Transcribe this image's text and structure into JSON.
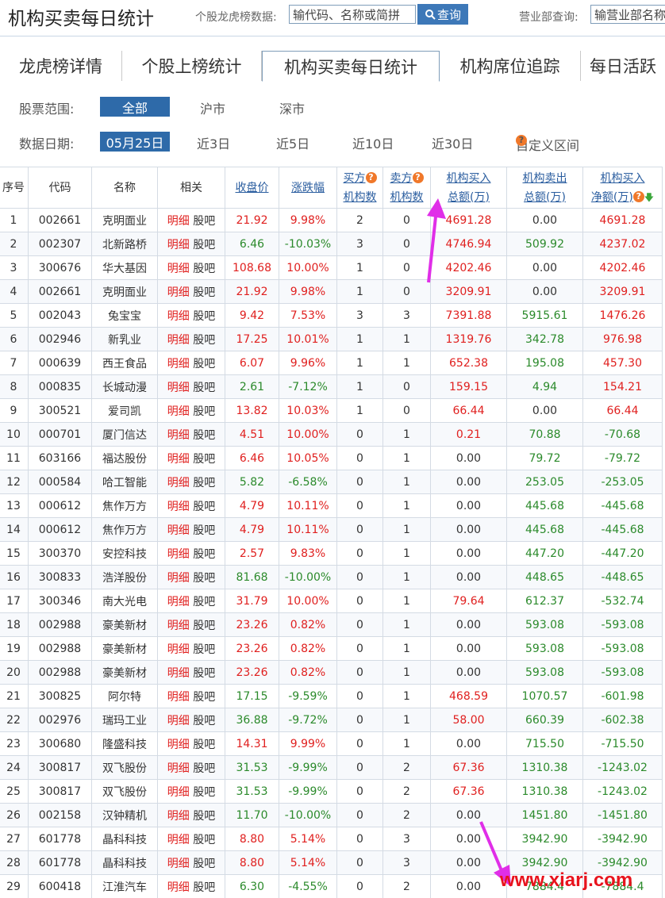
{
  "header": {
    "title": "机构买卖每日统计",
    "stock_label": "个股龙虎榜数据:",
    "stock_placeholder": "输代码、名称或简拼",
    "query_label": "查询",
    "branch_label": "营业部查询:",
    "branch_placeholder": "输营业部名称"
  },
  "tabs": [
    "龙虎榜详情",
    "个股上榜统计",
    "机构买卖每日统计",
    "机构席位追踪",
    "每日活跃"
  ],
  "filters": {
    "range_label": "股票范围:",
    "range_options": [
      "全部",
      "沪市",
      "深市"
    ],
    "date_label": "数据日期:",
    "date_options": [
      "05月25日",
      "近3日",
      "近5日",
      "近10日",
      "近30日",
      "自定义区间"
    ]
  },
  "table": {
    "headers": {
      "idx": "序号",
      "code": "代码",
      "name": "名称",
      "related": "相关",
      "close": "收盘价",
      "change": "涨跌幅",
      "buy_inst_1": "买方",
      "buy_inst_2": "机构数",
      "sell_inst_1": "卖方",
      "sell_inst_2": "机构数",
      "inst_buy_1": "机构买入",
      "inst_buy_2": "总额(万)",
      "inst_sell_1": "机构卖出",
      "inst_sell_2": "总额(万)",
      "inst_net_1": "机构买入",
      "inst_net_2": "净额(万)"
    },
    "link_detail": "明细",
    "link_forum": "股吧",
    "rows": [
      [
        "1",
        "002661",
        "克明面业",
        "21.92",
        "9.98%",
        "2",
        "0",
        "4691.28",
        "0.00",
        "4691.28"
      ],
      [
        "2",
        "002307",
        "北新路桥",
        "6.46",
        "-10.03%",
        "3",
        "0",
        "4746.94",
        "509.92",
        "4237.02"
      ],
      [
        "3",
        "300676",
        "华大基因",
        "108.68",
        "10.00%",
        "1",
        "0",
        "4202.46",
        "0.00",
        "4202.46"
      ],
      [
        "4",
        "002661",
        "克明面业",
        "21.92",
        "9.98%",
        "1",
        "0",
        "3209.91",
        "0.00",
        "3209.91"
      ],
      [
        "5",
        "002043",
        "兔宝宝",
        "9.42",
        "7.53%",
        "3",
        "3",
        "7391.88",
        "5915.61",
        "1476.26"
      ],
      [
        "6",
        "002946",
        "新乳业",
        "17.25",
        "10.01%",
        "1",
        "1",
        "1319.76",
        "342.78",
        "976.98"
      ],
      [
        "7",
        "000639",
        "西王食品",
        "6.07",
        "9.96%",
        "1",
        "1",
        "652.38",
        "195.08",
        "457.30"
      ],
      [
        "8",
        "000835",
        "长城动漫",
        "2.61",
        "-7.12%",
        "1",
        "0",
        "159.15",
        "4.94",
        "154.21"
      ],
      [
        "9",
        "300521",
        "爱司凯",
        "13.82",
        "10.03%",
        "1",
        "0",
        "66.44",
        "0.00",
        "66.44"
      ],
      [
        "10",
        "000701",
        "厦门信达",
        "4.51",
        "10.00%",
        "0",
        "1",
        "0.21",
        "70.88",
        "-70.68"
      ],
      [
        "11",
        "603166",
        "福达股份",
        "6.46",
        "10.05%",
        "0",
        "1",
        "0.00",
        "79.72",
        "-79.72"
      ],
      [
        "12",
        "000584",
        "哈工智能",
        "5.82",
        "-6.58%",
        "0",
        "1",
        "0.00",
        "253.05",
        "-253.05"
      ],
      [
        "13",
        "000612",
        "焦作万方",
        "4.79",
        "10.11%",
        "0",
        "1",
        "0.00",
        "445.68",
        "-445.68"
      ],
      [
        "14",
        "000612",
        "焦作万方",
        "4.79",
        "10.11%",
        "0",
        "1",
        "0.00",
        "445.68",
        "-445.68"
      ],
      [
        "15",
        "300370",
        "安控科技",
        "2.57",
        "9.83%",
        "0",
        "1",
        "0.00",
        "447.20",
        "-447.20"
      ],
      [
        "16",
        "300833",
        "浩洋股份",
        "81.68",
        "-10.00%",
        "0",
        "1",
        "0.00",
        "448.65",
        "-448.65"
      ],
      [
        "17",
        "300346",
        "南大光电",
        "31.79",
        "10.00%",
        "0",
        "1",
        "79.64",
        "612.37",
        "-532.74"
      ],
      [
        "18",
        "002988",
        "豪美新材",
        "23.26",
        "0.82%",
        "0",
        "1",
        "0.00",
        "593.08",
        "-593.08"
      ],
      [
        "19",
        "002988",
        "豪美新材",
        "23.26",
        "0.82%",
        "0",
        "1",
        "0.00",
        "593.08",
        "-593.08"
      ],
      [
        "20",
        "002988",
        "豪美新材",
        "23.26",
        "0.82%",
        "0",
        "1",
        "0.00",
        "593.08",
        "-593.08"
      ],
      [
        "21",
        "300825",
        "阿尔特",
        "17.15",
        "-9.59%",
        "0",
        "1",
        "468.59",
        "1070.57",
        "-601.98"
      ],
      [
        "22",
        "002976",
        "瑞玛工业",
        "36.88",
        "-9.72%",
        "0",
        "1",
        "58.00",
        "660.39",
        "-602.38"
      ],
      [
        "23",
        "300680",
        "隆盛科技",
        "14.31",
        "9.99%",
        "0",
        "1",
        "0.00",
        "715.50",
        "-715.50"
      ],
      [
        "24",
        "300817",
        "双飞股份",
        "31.53",
        "-9.99%",
        "0",
        "2",
        "67.36",
        "1310.38",
        "-1243.02"
      ],
      [
        "25",
        "300817",
        "双飞股份",
        "31.53",
        "-9.99%",
        "0",
        "2",
        "67.36",
        "1310.38",
        "-1243.02"
      ],
      [
        "26",
        "002158",
        "汉钟精机",
        "11.70",
        "-10.00%",
        "0",
        "2",
        "0.00",
        "1451.80",
        "-1451.80"
      ],
      [
        "27",
        "601778",
        "晶科科技",
        "8.80",
        "5.14%",
        "0",
        "3",
        "0.00",
        "3942.90",
        "-3942.90"
      ],
      [
        "28",
        "601778",
        "晶科科技",
        "8.80",
        "5.14%",
        "0",
        "3",
        "0.00",
        "3942.90",
        "-3942.90"
      ],
      [
        "29",
        "600418",
        "江淮汽车",
        "6.30",
        "-4.55%",
        "0",
        "2",
        "0.00",
        "7884.4",
        "-7884.4"
      ]
    ]
  },
  "watermark": "www.xiarj.com",
  "colors": {
    "accent": "#2e6aa9",
    "up": "#e0201f",
    "down": "#2b8a2b",
    "annotation": "#e02ee8"
  }
}
